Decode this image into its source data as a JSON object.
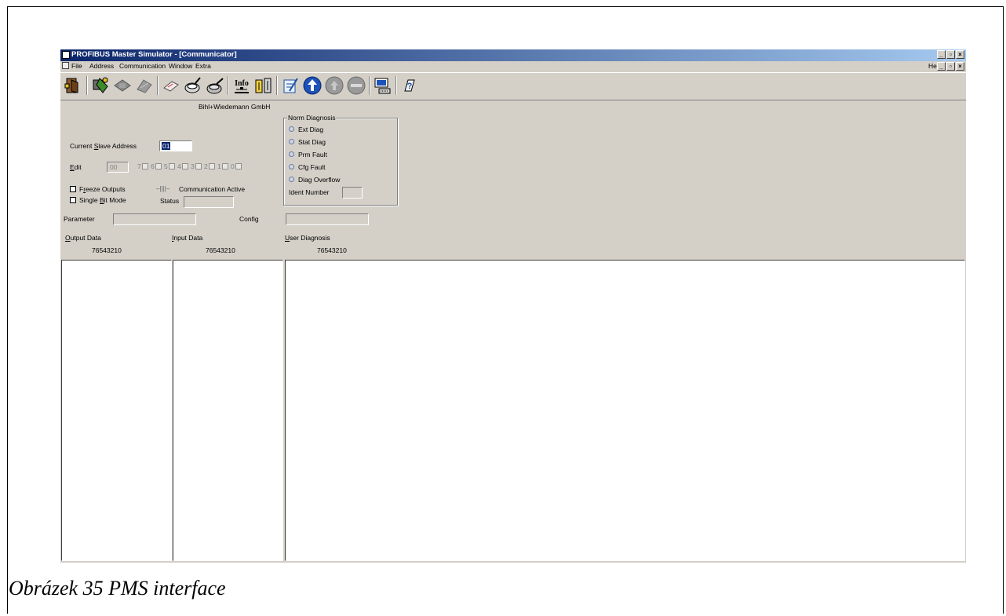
{
  "window": {
    "title": "PROFIBUS Master Simulator - [Communicator]"
  },
  "menu": {
    "items": [
      "File",
      "Address",
      "Communication",
      "Window",
      "Extra"
    ],
    "help": "Help"
  },
  "toolbar": {
    "info_label": "Info",
    "icons": [
      "exit-icon",
      "scan-icon",
      "write-icon",
      "read-icon",
      "eraser-icon",
      "monitor-icon",
      "config-icon",
      "info-icon",
      "settings-icon",
      "edit-icon",
      "up-arrow-icon",
      "up-circle-icon",
      "stop-icon",
      "network-icon",
      "help-icon"
    ]
  },
  "form": {
    "company": "Bihl+Wiedemann GmbH",
    "current_slave_label_pre": "Current ",
    "current_slave_label_ul": "S",
    "current_slave_label_post": "lave Address",
    "current_slave_value": "01",
    "edit_label_ul": "E",
    "edit_label_post": "dit",
    "edit_value": "00",
    "bit_labels": [
      "7",
      "6",
      "5",
      "4",
      "3",
      "2",
      "1",
      "0"
    ],
    "freeze_pre": "F",
    "freeze_ul": "r",
    "freeze_post": "eeze Outputs",
    "single_pre": "Single ",
    "single_ul": "B",
    "single_post": "it Mode",
    "comm_glyph": "–||||–",
    "comm_active": "Communication Active",
    "status_label": "Status",
    "parameter_label": "Parameter",
    "config_label": "Config",
    "output_ul": "O",
    "output_post": "utput Data",
    "input_ul": "I",
    "input_post": "nput Data",
    "user_ul": "U",
    "user_post": "ser Diagnosis",
    "bit_header": "76543210"
  },
  "norm_diagnosis": {
    "title": "Norm Diagnosis",
    "items": [
      "Ext Diag",
      "Stat Diag",
      "Prm Fault",
      "Cfg Fault",
      "Diag Overflow"
    ],
    "ident_label": "Ident Number"
  },
  "caption": "Obrázek 35 PMS interface"
}
